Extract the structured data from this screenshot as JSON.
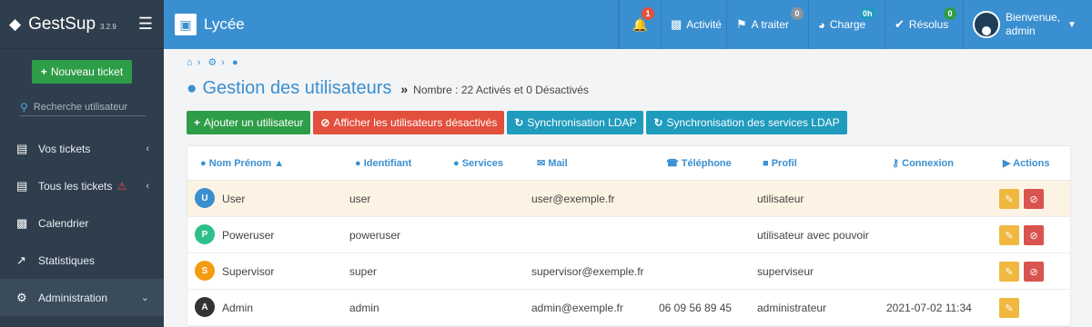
{
  "app": {
    "name": "GestSup",
    "version": "3.2.9"
  },
  "sidebar": {
    "new_ticket": "Nouveau ticket",
    "search_placeholder": "Recherche utilisateur",
    "items": [
      {
        "label": "Vos tickets"
      },
      {
        "label": "Tous les tickets"
      },
      {
        "label": "Calendrier"
      },
      {
        "label": "Statistiques"
      },
      {
        "label": "Administration"
      }
    ]
  },
  "topbar": {
    "context": "Lycée",
    "notifications_count": "1",
    "activity": "Activité",
    "to_process": "A traiter",
    "to_process_count": "0",
    "load": "Charge",
    "load_badge": "0h",
    "resolved": "Résolus",
    "resolved_count": "0",
    "greeting": "Bienvenue,",
    "username": "admin"
  },
  "page": {
    "title": "Gestion des utilisateurs",
    "subtitle": "Nombre : 22 Activés et 0 Désactivés"
  },
  "buttons": {
    "add_user": "Ajouter un utilisateur",
    "show_disabled": "Afficher les utilisateurs désactivés",
    "ldap_sync": "Synchronisation LDAP",
    "ldap_services_sync": "Synchronisation des services LDAP"
  },
  "table": {
    "headers": {
      "name": "Nom Prénom",
      "login": "Identifiant",
      "services": "Services",
      "mail": "Mail",
      "phone": "Téléphone",
      "profile": "Profil",
      "connection": "Connexion",
      "actions": "Actions"
    },
    "rows": [
      {
        "initial": "U",
        "name": "User",
        "login": "user",
        "mail": "user@exemple.fr",
        "phone": "",
        "profile": "utilisateur",
        "connection": ""
      },
      {
        "initial": "P",
        "name": "Poweruser",
        "login": "poweruser",
        "mail": "",
        "phone": "",
        "profile": "utilisateur avec pouvoir",
        "connection": ""
      },
      {
        "initial": "S",
        "name": "Supervisor",
        "login": "super",
        "mail": "supervisor@exemple.fr",
        "phone": "",
        "profile": "superviseur",
        "connection": ""
      },
      {
        "initial": "A",
        "name": "Admin",
        "login": "admin",
        "mail": "admin@exemple.fr",
        "phone": "06 09 56 89 45",
        "profile": "administrateur",
        "connection": "2021-07-02 11:34"
      }
    ]
  },
  "colors": {
    "primary": "#3a8fd0",
    "sidebar": "#2f3e4c",
    "green": "#2e9d48",
    "red": "#e24f3c",
    "teal": "#1f9bbd",
    "avatar_user": "#3a8fd0",
    "avatar_poweruser": "#2ebf8a",
    "avatar_supervisor": "#f39c12",
    "avatar_admin": "#333333"
  }
}
